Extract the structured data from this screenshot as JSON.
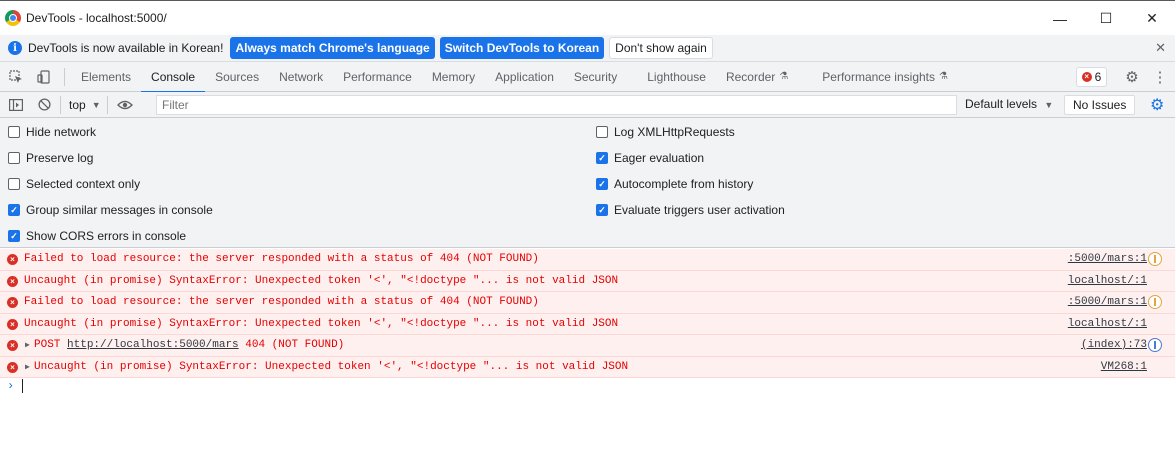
{
  "window": {
    "title": "DevTools - localhost:5000/",
    "minimize": "—",
    "maximize": "☐",
    "close": "✕"
  },
  "infobar": {
    "message": "DevTools is now available in Korean!",
    "btn_match": "Always match Chrome's language",
    "btn_switch": "Switch DevTools to Korean",
    "btn_dismiss": "Don't show again",
    "close": "✕"
  },
  "tabs": {
    "items": [
      "Elements",
      "Console",
      "Sources",
      "Network",
      "Performance",
      "Memory",
      "Application",
      "Security",
      "Lighthouse",
      "Recorder",
      "Performance insights"
    ],
    "active": "Console",
    "error_count": "6"
  },
  "toolbar": {
    "context": "top",
    "filter_placeholder": "Filter",
    "levels": "Default levels",
    "issues": "No Issues"
  },
  "settings": {
    "left": [
      {
        "label": "Hide network",
        "checked": false
      },
      {
        "label": "Preserve log",
        "checked": false
      },
      {
        "label": "Selected context only",
        "checked": false
      },
      {
        "label": "Group similar messages in console",
        "checked": true
      },
      {
        "label": "Show CORS errors in console",
        "checked": true
      }
    ],
    "right": [
      {
        "label": "Log XMLHttpRequests",
        "checked": false
      },
      {
        "label": "Eager evaluation",
        "checked": true
      },
      {
        "label": "Autocomplete from history",
        "checked": true
      },
      {
        "label": "Evaluate triggers user activation",
        "checked": true
      }
    ]
  },
  "messages": [
    {
      "text": "Failed to load resource: the server responded with a status of 404 (NOT FOUND)",
      "source": ":5000/mars:1",
      "badge": "orange"
    },
    {
      "text": "Uncaught (in promise) SyntaxError: Unexpected token '<', \"<!doctype \"... is not valid JSON",
      "source": "localhost/:1",
      "badge": ""
    },
    {
      "text": "Failed to load resource: the server responded with a status of 404 (NOT FOUND)",
      "source": ":5000/mars:1",
      "badge": "orange"
    },
    {
      "text": "Uncaught (in promise) SyntaxError: Unexpected token '<', \"<!doctype \"... is not valid JSON",
      "source": "localhost/:1",
      "badge": ""
    },
    {
      "prefix": "POST ",
      "link": "http://localhost:5000/mars",
      "suffix": " 404 (NOT FOUND)",
      "source": "(index):73",
      "badge": "blue",
      "expandable": true
    },
    {
      "text": "Uncaught (in promise) SyntaxError: Unexpected token '<', \"<!doctype \"... is not valid JSON",
      "source": "VM268:1",
      "badge": "",
      "expandable": true
    }
  ],
  "prompt": "›",
  "colors": {
    "accent": "#1a73e8",
    "error_text": "#e50000",
    "error_bg": "#fff0f0"
  }
}
